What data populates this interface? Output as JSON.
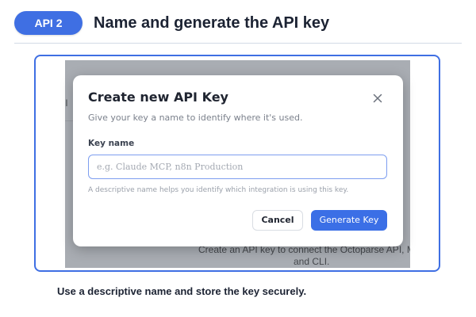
{
  "header": {
    "step_label": "API 2",
    "title": "Name and generate the API key"
  },
  "background": {
    "side_text": "ll",
    "line1": "Create an API key to connect the Octoparse API, M",
    "line2": "and CLI."
  },
  "modal": {
    "title": "Create new API Key",
    "subtitle": "Give your key a name to identify where it's used.",
    "field_label": "Key name",
    "field_value": "",
    "field_placeholder": "e.g. Claude MCP, n8n Production",
    "field_help": "A descriptive name helps you identify which integration is using this key.",
    "cancel_label": "Cancel",
    "generate_label": "Generate Key",
    "close_icon": "close-icon"
  },
  "caption": "Use a descriptive name and store the key securely.",
  "colors": {
    "accent": "#3f6fe3",
    "button_primary": "#3b6fe6",
    "overlay": "#a9adb3"
  }
}
